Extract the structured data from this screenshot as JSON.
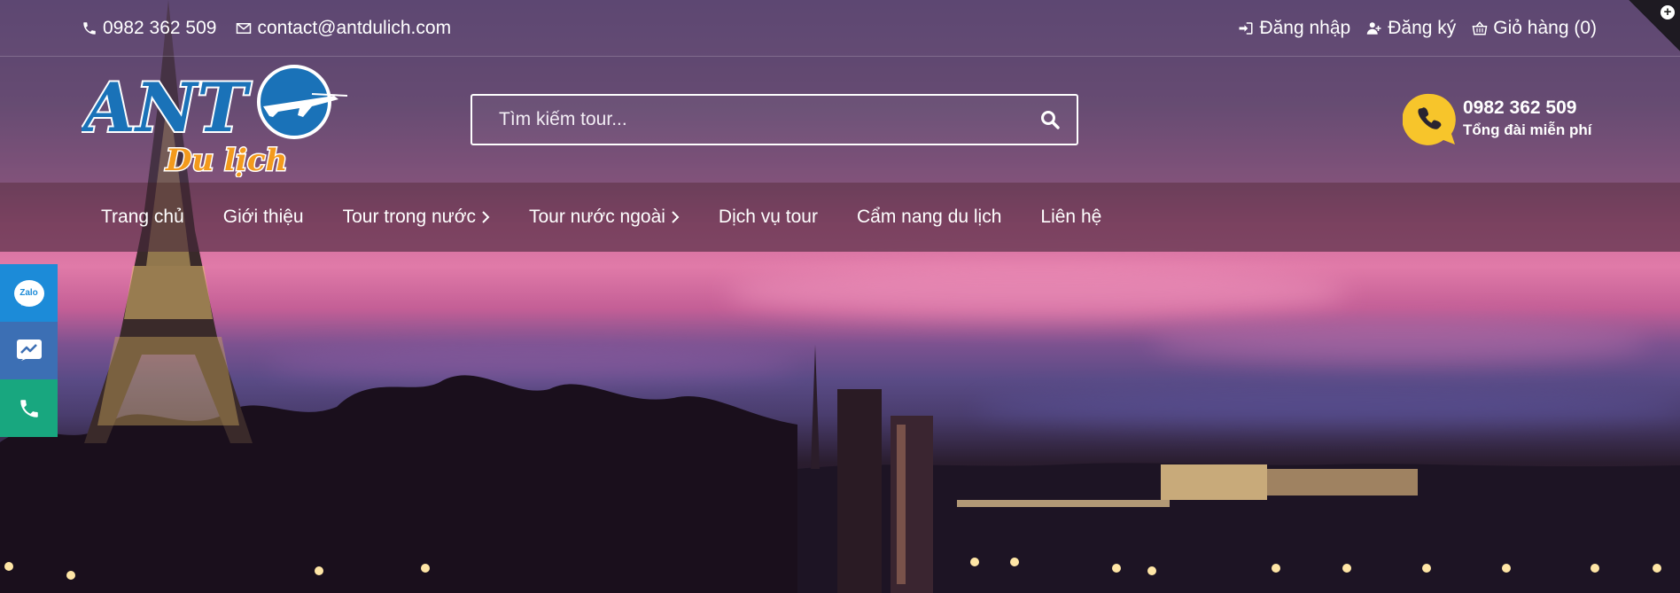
{
  "topbar": {
    "phone": "0982 362 509",
    "email": "contact@antdulich.com",
    "login": "Đăng nhập",
    "register": "Đăng ký",
    "cart": "Giỏ hàng (0)"
  },
  "logo": {
    "line1": "ANT",
    "line2": "Du lịch"
  },
  "search": {
    "placeholder": "Tìm kiếm tour..."
  },
  "hotline": {
    "number": "0982 362 509",
    "caption": "Tổng đài miễn phí"
  },
  "nav": [
    {
      "label": "Trang chủ",
      "has_submenu": false
    },
    {
      "label": "Giới thiệu",
      "has_submenu": false
    },
    {
      "label": "Tour trong nước",
      "has_submenu": true
    },
    {
      "label": "Tour nước ngoài",
      "has_submenu": true
    },
    {
      "label": "Dịch vụ tour",
      "has_submenu": false
    },
    {
      "label": "Cẩm nang du lịch",
      "has_submenu": false
    },
    {
      "label": "Liên hệ",
      "has_submenu": false
    }
  ],
  "side_contact": {
    "zalo_label": "Zalo"
  },
  "colors": {
    "zalo": "#1c8bd8",
    "messenger": "#3c6fb4",
    "call": "#18a77f",
    "logo_blue": "#1a72b8",
    "logo_orange": "#f39a1c",
    "hotline_yellow": "#f7c52b"
  },
  "icons": [
    "phone-icon",
    "envelope-icon",
    "sign-in-icon",
    "user-plus-icon",
    "shopping-basket-icon",
    "search-icon",
    "phone-bubble-icon",
    "chevron-right-icon",
    "zalo-icon",
    "messenger-icon",
    "call-icon",
    "plus-circle-icon"
  ]
}
